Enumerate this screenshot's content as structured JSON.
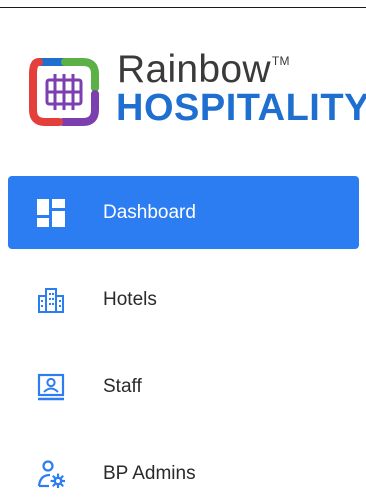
{
  "brand": {
    "name_top": "Rainbow",
    "trademark": "TM",
    "name_bottom": "HOSPITALITY",
    "logo_icon": "rainbow-logo-icon",
    "colors": {
      "blue": "#1f6fd1",
      "green": "#5bb146",
      "red": "#e43f3a",
      "purple": "#7b3fb0",
      "text": "#3a3a3a"
    }
  },
  "nav": {
    "active_color": "#2c7df1",
    "icon_color": "#2c7df1",
    "items": [
      {
        "label": "Dashboard",
        "icon": "dashboard-grid-icon",
        "active": true
      },
      {
        "label": "Hotels",
        "icon": "building-icon",
        "active": false
      },
      {
        "label": "Staff",
        "icon": "staff-badge-icon",
        "active": false
      },
      {
        "label": "BP Admins",
        "icon": "user-gear-icon",
        "active": false
      }
    ]
  }
}
